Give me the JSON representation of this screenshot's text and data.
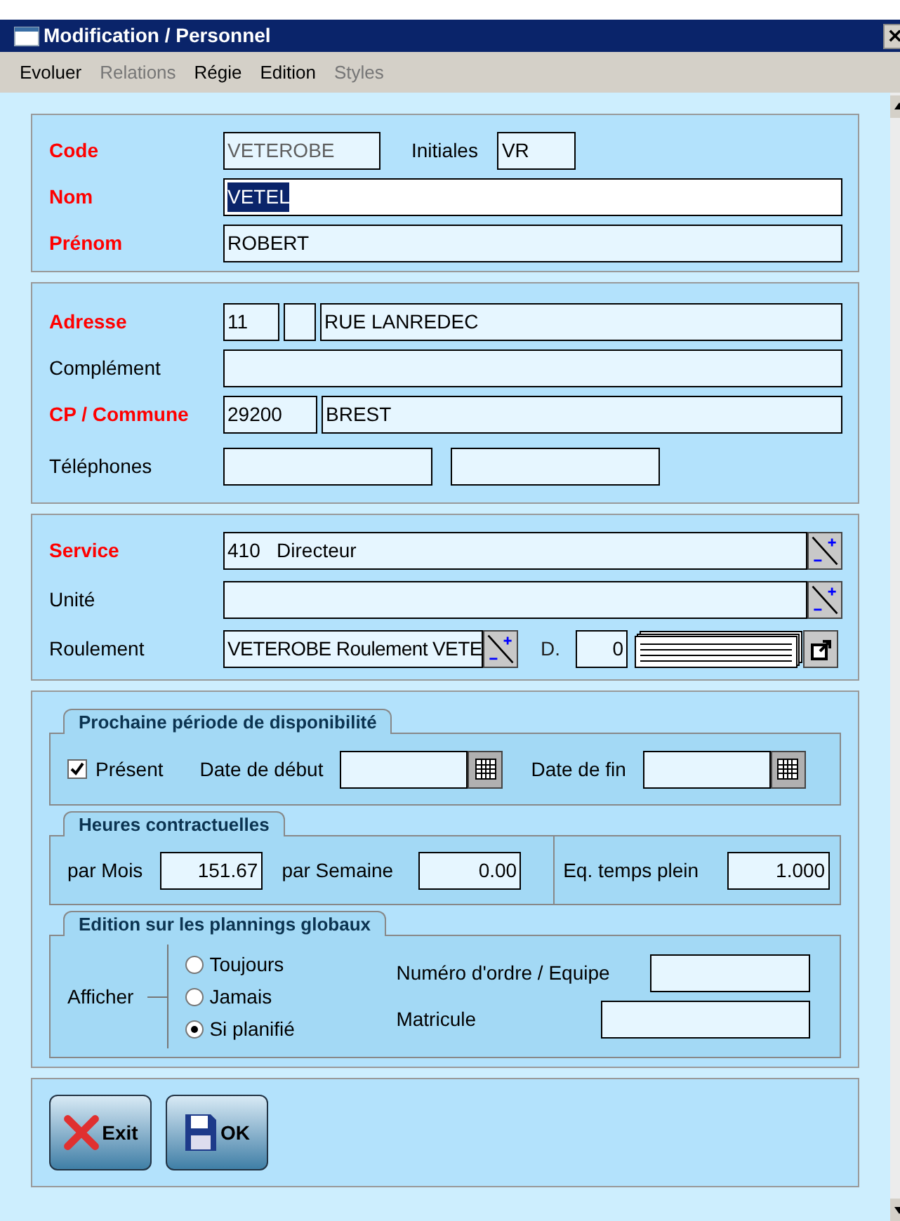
{
  "window": {
    "title": "Modification / Personnel"
  },
  "menu": [
    {
      "label": "Evoluer",
      "disabled": false
    },
    {
      "label": "Relations",
      "disabled": true
    },
    {
      "label": "Régie",
      "disabled": false
    },
    {
      "label": "Edition",
      "disabled": false
    },
    {
      "label": "Styles",
      "disabled": true
    }
  ],
  "identity": {
    "code": {
      "label": "Code",
      "required": true,
      "value": "VETEROBE",
      "disabled": true
    },
    "initiales": {
      "label": "Initiales",
      "required": false,
      "value": "VR"
    },
    "nom": {
      "label": "Nom",
      "required": true,
      "value": "VETEL",
      "highlighted": true
    },
    "prenom": {
      "label": "Prénom",
      "required": true,
      "value": "ROBERT"
    }
  },
  "address": {
    "adresse": {
      "label": "Adresse",
      "required": true,
      "number": "11",
      "street": "RUE LANREDEC"
    },
    "complement": {
      "label": "Complément",
      "required": false
    },
    "commune": {
      "label": "CP / Commune",
      "required": true,
      "postcode": "29200",
      "city": "BREST"
    },
    "telephones": {
      "label": "Téléphones",
      "required": false
    }
  },
  "assignment": {
    "service": {
      "label": "Service",
      "required": true,
      "value": "410   Directeur"
    },
    "unite": {
      "label": "Unité",
      "required": false
    },
    "roulement": {
      "label": "Roulement",
      "required": false,
      "value": "VETEROBE Roulement VETE",
      "d_label": "D.",
      "d_value": "0"
    }
  },
  "availability": {
    "title": "Prochaine période de disponibilité",
    "present": {
      "label": "Présent",
      "checked": true
    },
    "start_label": "Date de début",
    "end_label": "Date de fin"
  },
  "hours": {
    "title": "Heures contractuelles",
    "month_label": "par Mois",
    "month": "151.67",
    "week_label": "par Semaine",
    "week": "0.00",
    "fte_label": "Eq. temps plein",
    "fte": "1.000"
  },
  "planning": {
    "title": "Edition sur les plannings globaux",
    "afficher": "Afficher",
    "options": [
      {
        "label": "Toujours",
        "selected": false
      },
      {
        "label": "Jamais",
        "selected": false
      },
      {
        "label": "Si planifié",
        "selected": true
      }
    ],
    "order_label": "Numéro d'ordre / Equipe",
    "matricule_label": "Matricule"
  },
  "buttons": [
    {
      "kind": "exit",
      "label": "Exit"
    },
    {
      "kind": "ok",
      "label": "OK"
    }
  ]
}
